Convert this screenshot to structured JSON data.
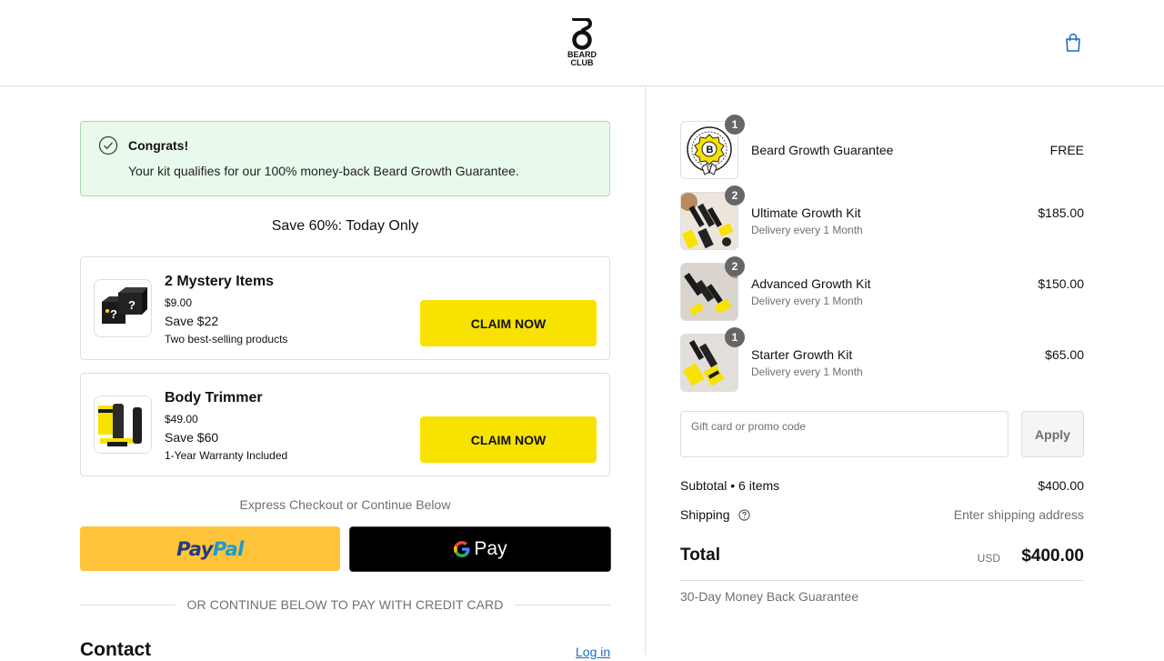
{
  "header": {
    "logo_text_1": "BEARD",
    "logo_text_2": "CLUB",
    "cart_icon": "shopping-bag-icon",
    "brand_color": "#1b6cc0"
  },
  "banner": {
    "icon": "check-circle-icon",
    "title": "Congrats!",
    "message": "Your kit qualifies for our 100% money-back Beard Growth Guarantee."
  },
  "upsell": {
    "headline": "Save 60%: Today Only",
    "offers": [
      {
        "name": "2 Mystery Items",
        "price": "$9.00",
        "save": "Save $22",
        "note": "Two best-selling products",
        "button": "CLAIM NOW"
      },
      {
        "name": "Body Trimmer",
        "price": "$49.00",
        "save": "Save $60",
        "note": "1-Year Warranty Included",
        "button": "CLAIM NOW"
      }
    ],
    "button_color": "#f7e200"
  },
  "express": {
    "label": "Express Checkout or Continue Below",
    "paypal_1": "Pay",
    "paypal_2": "Pal",
    "gpay": "Pay"
  },
  "divider_text": "OR CONTINUE BELOW TO PAY WITH CREDIT CARD",
  "contact": {
    "title": "Contact",
    "login": "Log in"
  },
  "summary": {
    "items": [
      {
        "qty": "1",
        "name": "Beard Growth Guarantee",
        "sub": "",
        "price": "FREE"
      },
      {
        "qty": "2",
        "name": "Ultimate Growth Kit",
        "sub": "Delivery every 1 Month",
        "price": "$185.00"
      },
      {
        "qty": "2",
        "name": "Advanced Growth Kit",
        "sub": "Delivery every 1 Month",
        "price": "$150.00"
      },
      {
        "qty": "1",
        "name": "Starter Growth Kit",
        "sub": "Delivery every 1 Month",
        "price": "$65.00"
      }
    ],
    "promo_placeholder": "Gift card or promo code",
    "apply": "Apply",
    "subtotal_label": "Subtotal • 6 items",
    "subtotal_value": "$400.00",
    "shipping_label": "Shipping",
    "shipping_value": "Enter shipping address",
    "total_label": "Total",
    "currency": "USD",
    "total_value": "$400.00",
    "guarantee": "30-Day Money Back Guarantee"
  }
}
